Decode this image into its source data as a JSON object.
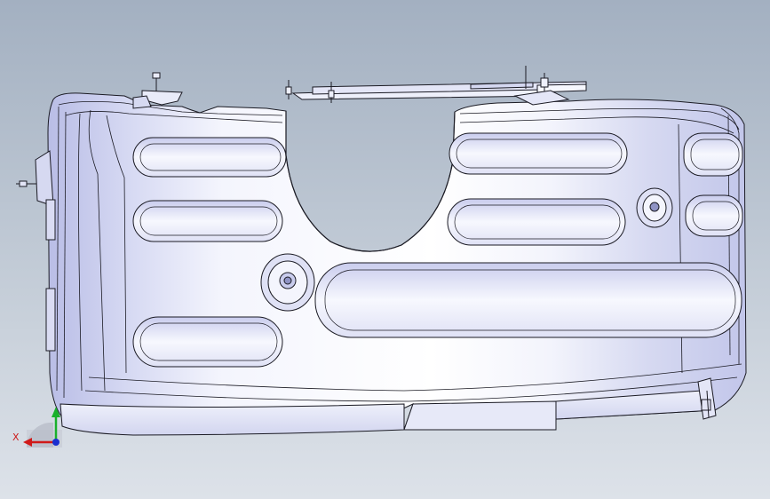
{
  "triad": {
    "x_label": "X",
    "x_color": "#d01a1a",
    "y_color": "#19b02b",
    "z_color": "#1a2fd0"
  },
  "model": {
    "body_color": "#eceef9",
    "shade_color": "#bcc0e6",
    "edge_color": "#1b1b24",
    "background_top": "#a3b0c1",
    "background_bottom": "#dde2e9"
  }
}
